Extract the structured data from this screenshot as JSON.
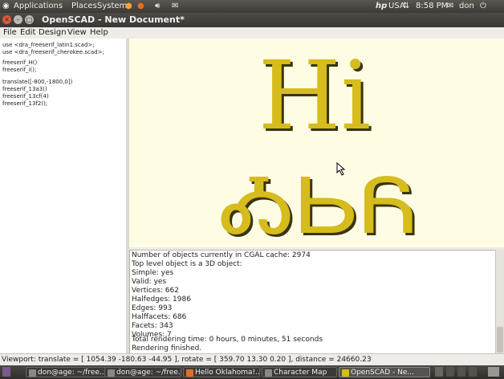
{
  "top_panel": {
    "menus": [
      "Applications",
      "Places",
      "System"
    ],
    "locale": "USA",
    "clock": "8:58 PM",
    "user": "don"
  },
  "window": {
    "title": "OpenSCAD - New Document*"
  },
  "menubar": [
    "File",
    "Edit",
    "Design",
    "View",
    "Help"
  ],
  "editor": {
    "lines": [
      "use <dra_freeserif_latin1.scad>;",
      "use <dra_freeserif_cherokee.scad>;",
      "",
      "freeserif_H()",
      "freeserif_i();",
      "",
      "translate([-800,-1800,0])",
      "freeserif_13a3()",
      "freeserif_13cf(4)",
      "freeserif_13f2();"
    ]
  },
  "viewport": {
    "render_text_top": "Hi",
    "render_text_bottom": "ᎣᏏᏲ",
    "render_color": "#d6bc1c",
    "background": "#fefde4"
  },
  "console": {
    "lines": [
      "Number of objects currently in CGAL cache: 2974",
      "   Top level object is a 3D object:",
      "   Simple:        yes",
      "   Valid:          yes",
      "   Vertices:      662",
      "   Halfedges:    1986",
      "   Edges:         993",
      "   Halffacets:    686",
      "   Facets:        343",
      "   Volumes:         7",
      "Total rendering time: 0 hours, 0 minutes, 51 seconds",
      "Rendering finished."
    ]
  },
  "status_bar": "Viewport: translate = [ 1054.39 -180.63 -44.95 ], rotate = [ 359.70 13.30 0.20 ], distance = 24660.23",
  "taskbar": {
    "tasks": [
      "don@age: ~/free...",
      "don@age: ~/free...",
      "Hello Oklahoma!...",
      "Character Map",
      "OpenSCAD - Ne..."
    ]
  }
}
